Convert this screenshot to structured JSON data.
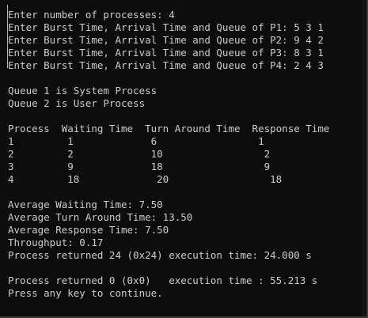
{
  "console": {
    "lines": [
      "Enter number of processes: 4",
      "Enter Burst Time, Arrival Time and Queue of P1: 5 3 1",
      "Enter Burst Time, Arrival Time and Queue of P2: 9 4 2",
      "Enter Burst Time, Arrival Time and Queue of P3: 8 3 1",
      "Enter Burst Time, Arrival Time and Queue of P4: 2 4 3",
      "",
      "Queue 1 is System Process",
      "Queue 2 is User Process",
      "",
      "Process  Waiting Time  Turn Around Time  Response Time",
      "1         1             6                 1",
      "2         2             10                 2",
      "3         9             18                 9",
      "4         18             20                 18",
      "",
      "Average Waiting Time: 7.50",
      "Average Turn Around Time: 13.50",
      "Average Response Time: 7.50",
      "Throughput: 0.17",
      "Process returned 24 (0x24) execution time: 24.000 s",
      "",
      "Process returned 0 (0x0)   execution time : 55.213 s",
      "Press any key to continue."
    ]
  },
  "colors": {
    "background": "#0c0c0c",
    "text": "#cccccc"
  }
}
